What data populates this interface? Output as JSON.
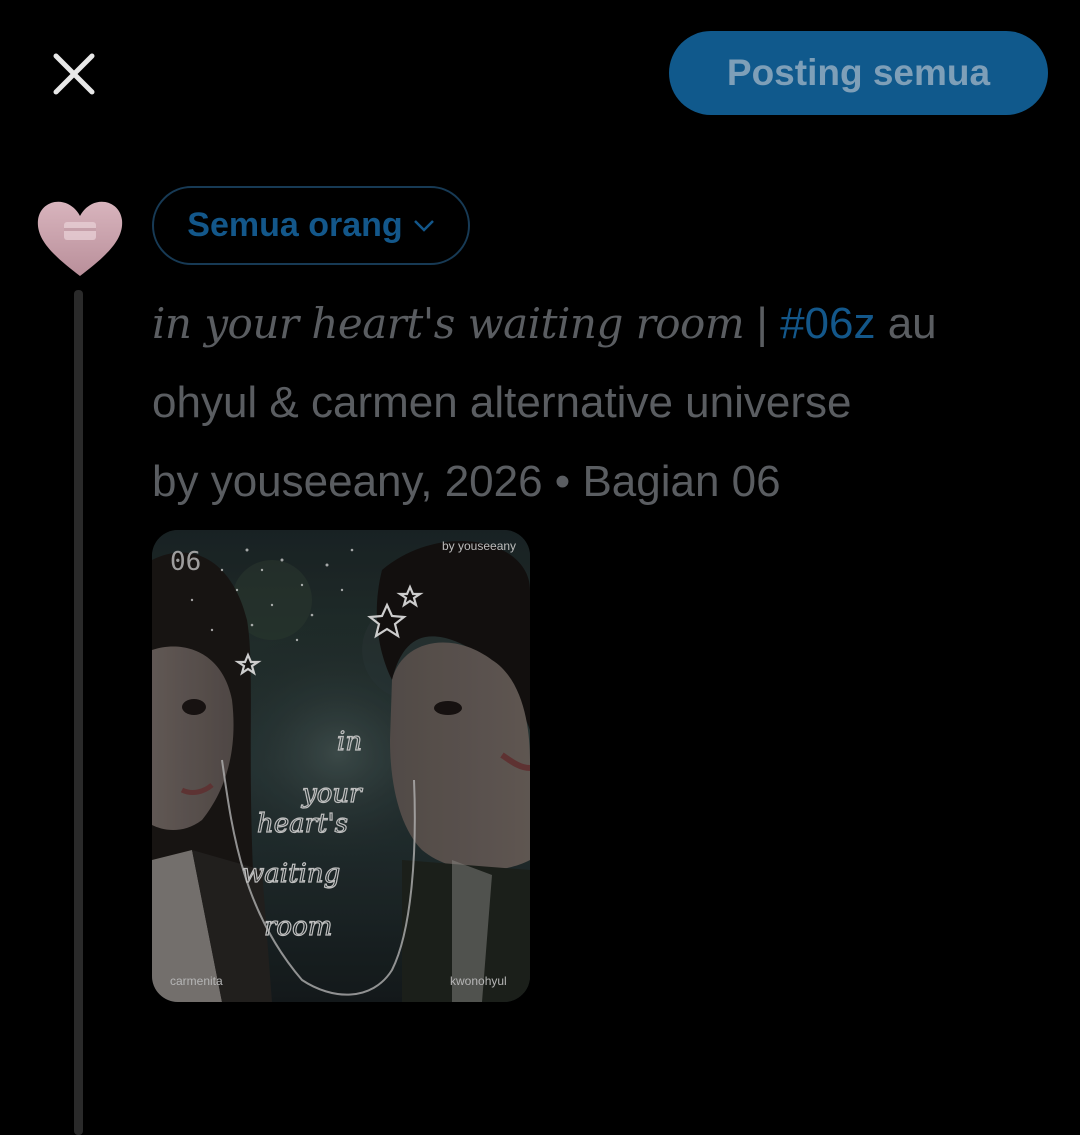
{
  "header": {
    "close_icon": "close-icon",
    "post_all_label": "Posting semua",
    "post_all_color": "#10598c"
  },
  "composer": {
    "avatar_icon": "heart-avatar",
    "audience_label": "Semua orang",
    "audience_icon": "chevron-down-icon",
    "title": "in your heart's waiting room",
    "separator": " | ",
    "hashtag": "#06z",
    "after_hashtag": " au",
    "line2": "ohyul & carmen alternative universe",
    "line3": "by youseeany, 2026 • Bagian 06"
  },
  "media": {
    "number": "06",
    "byline": "by youseeany",
    "cover_text": [
      "in",
      "your",
      "heart's",
      "waiting",
      "room"
    ],
    "left_name": "carmenita",
    "right_name": "kwonohyul"
  },
  "colors": {
    "accent": "#13578a",
    "text_muted": "#5a5d61",
    "thread_line": "#2a2a2a"
  }
}
